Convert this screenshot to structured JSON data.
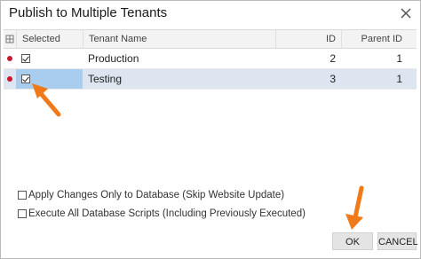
{
  "dialog": {
    "title": "Publish to Multiple Tenants"
  },
  "grid": {
    "columns": {
      "selected": "Selected",
      "tenant_name": "Tenant Name",
      "id": "ID",
      "parent_id": "Parent ID"
    },
    "rows": [
      {
        "selected": true,
        "tenant_name": "Production",
        "id": "2",
        "parent_id": "1"
      },
      {
        "selected": true,
        "tenant_name": "Testing",
        "id": "3",
        "parent_id": "1"
      }
    ]
  },
  "options": {
    "apply_db_only": {
      "label": "Apply Changes Only to Database (Skip Website Update)",
      "checked": false
    },
    "execute_all_scripts": {
      "label": "Execute All Database Scripts (Including Previously Executed)",
      "checked": false
    }
  },
  "buttons": {
    "ok": "OK",
    "cancel": "CANCEL"
  },
  "colors": {
    "annotation_arrow": "#f07a1a",
    "row_indicator": "#c9182e",
    "active_row": "#dde6f0",
    "selected_cell": "#a9cdee"
  }
}
